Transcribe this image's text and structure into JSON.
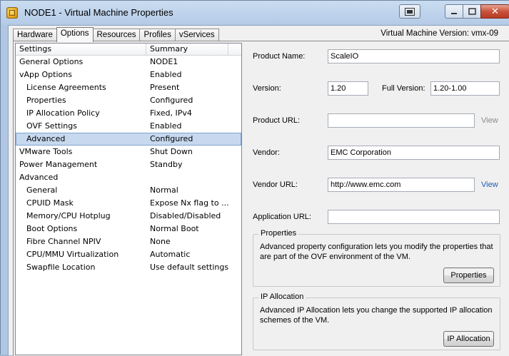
{
  "window": {
    "title": "NODE1 - Virtual Machine Properties",
    "close_glyph": "✕"
  },
  "tabs": [
    "Hardware",
    "Options",
    "Resources",
    "Profiles",
    "vServices"
  ],
  "vm_version": "Virtual Machine Version: vmx-09",
  "list": {
    "headers": {
      "settings": "Settings",
      "summary": "Summary"
    },
    "rows": [
      {
        "name": "General Options",
        "summary": "NODE1",
        "level": 0
      },
      {
        "name": "vApp Options",
        "summary": "Enabled",
        "level": 0
      },
      {
        "name": "License Agreements",
        "summary": "Present",
        "level": 1
      },
      {
        "name": "Properties",
        "summary": "Configured",
        "level": 1
      },
      {
        "name": "IP Allocation Policy",
        "summary": "Fixed, IPv4",
        "level": 1
      },
      {
        "name": "OVF Settings",
        "summary": "Enabled",
        "level": 1
      },
      {
        "name": "Advanced",
        "summary": "Configured",
        "level": 1,
        "selected": true
      },
      {
        "name": "VMware Tools",
        "summary": "Shut Down",
        "level": 0
      },
      {
        "name": "Power Management",
        "summary": "Standby",
        "level": 0
      },
      {
        "name": "Advanced",
        "summary": "",
        "level": 0
      },
      {
        "name": "General",
        "summary": "Normal",
        "level": 1
      },
      {
        "name": "CPUID Mask",
        "summary": "Expose Nx flag to ...",
        "level": 1
      },
      {
        "name": "Memory/CPU Hotplug",
        "summary": "Disabled/Disabled",
        "level": 1
      },
      {
        "name": "Boot Options",
        "summary": "Normal Boot",
        "level": 1
      },
      {
        "name": "Fibre Channel NPIV",
        "summary": "None",
        "level": 1
      },
      {
        "name": "CPU/MMU Virtualization",
        "summary": "Automatic",
        "level": 1
      },
      {
        "name": "Swapfile Location",
        "summary": "Use default settings",
        "level": 1
      }
    ]
  },
  "form": {
    "product_name": {
      "label": "Product Name:",
      "value": "ScaleIO"
    },
    "version": {
      "label": "Version:",
      "value": "1.20"
    },
    "full_version": {
      "label": "Full Version:",
      "value": "1.20-1.00"
    },
    "product_url": {
      "label": "Product URL:",
      "value": "",
      "link": "View"
    },
    "vendor": {
      "label": "Vendor:",
      "value": "EMC Corporation"
    },
    "vendor_url": {
      "label": "Vendor URL:",
      "value": "http://www.emc.com",
      "link": "View"
    },
    "application_url": {
      "label": "Application URL:",
      "value": ""
    }
  },
  "properties_group": {
    "title": "Properties",
    "text": "Advanced property configuration lets you modify the properties that are part of the OVF environment of the VM.",
    "button": "Properties"
  },
  "ip_group": {
    "title": "IP Allocation",
    "text": "Advanced IP Allocation lets you change the supported IP allocation schemes of the VM.",
    "button": "IP Allocation"
  },
  "colors": {
    "selection": "#c7d9ef",
    "link": "#1a5fb4",
    "close_button": "#c9533a"
  }
}
